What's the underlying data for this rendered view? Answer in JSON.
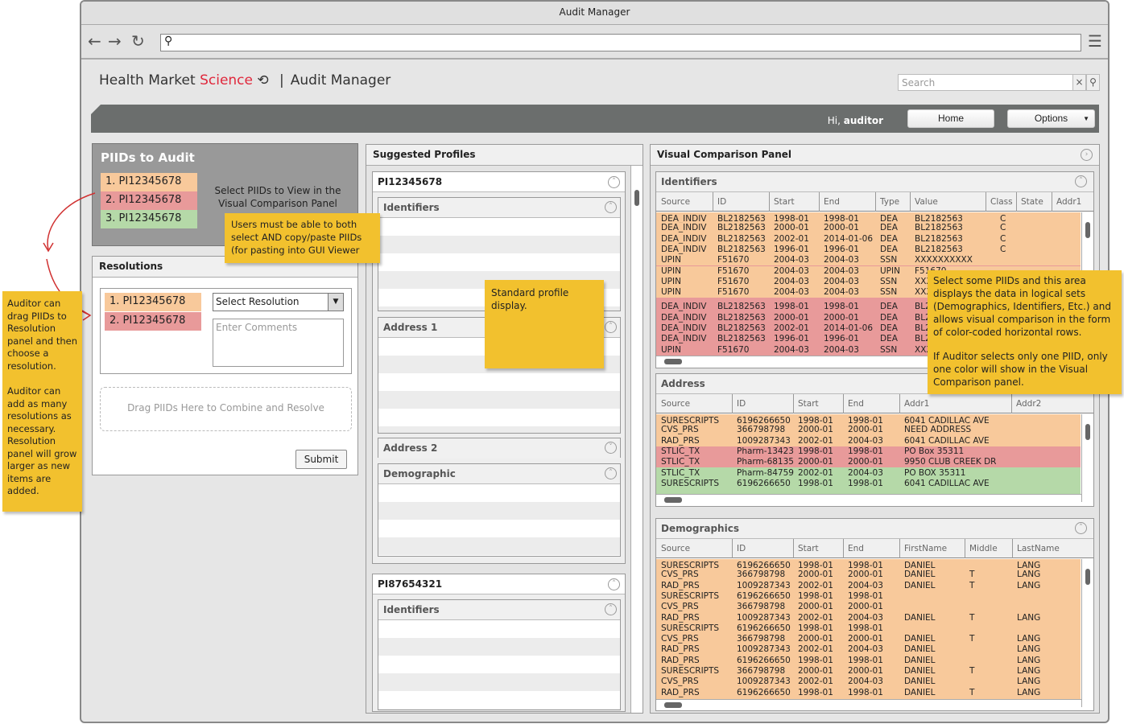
{
  "window": {
    "title": "Audit Manager"
  },
  "browser": {
    "back": "←",
    "forward": "→",
    "reload": "↻",
    "menu": "☰"
  },
  "header": {
    "brand_a": "Health Market ",
    "brand_b": "Science",
    "separator": "|",
    "app": "Audit Manager",
    "search_placeholder": "Search",
    "greeting": "Hi, ",
    "user": "auditor",
    "home": "Home",
    "options": "Options"
  },
  "piids_panel": {
    "title": "PIIDs to Audit",
    "hint": "Select PIIDs to View in the Visual Comparison Panel",
    "items": [
      {
        "label": "1.  PI12345678",
        "color": "#f8c99b"
      },
      {
        "label": "2.  PI12345678",
        "color": "#e89a9a"
      },
      {
        "label": "3.  PI12345678",
        "color": "#b5d9a8"
      }
    ]
  },
  "resolutions": {
    "title": "Resolutions",
    "items": [
      "1.  PI12345678",
      "2.  PI12345678"
    ],
    "select_value": "Select Resolution",
    "comments_placeholder": "Enter Comments",
    "drop_zone": "Drag PIIDs Here to Combine and Resolve",
    "submit": "Submit"
  },
  "suggested": {
    "title": "Suggested Profiles",
    "profiles": [
      {
        "id": "PI12345678",
        "sections": [
          "Identifiers",
          "Address 1",
          "Address 2",
          "Demographic"
        ]
      },
      {
        "id": "PI87654321",
        "sections": [
          "Identifiers"
        ]
      }
    ]
  },
  "visual": {
    "title": "Visual Comparison Panel",
    "identifiers": {
      "title": "Identifiers",
      "columns": [
        "Source",
        "ID",
        "Start",
        "End",
        "Type",
        "Value",
        "Class",
        "State",
        "Addr1"
      ],
      "rows": [
        {
          "c": "o",
          "v": [
            "DEA_INDIV",
            "BL2182563",
            "1998-01",
            "1998-01",
            "DEA",
            "BL2182563",
            "C",
            "",
            ""
          ]
        },
        {
          "c": "o",
          "v": [
            "DEA_INDIV",
            "BL2182563",
            "2000-01",
            "2000-01",
            "DEA",
            "BL2182563",
            "C",
            "",
            ""
          ]
        },
        {
          "c": "o",
          "v": [
            "DEA_INDIV",
            "BL2182563",
            "2002-01",
            "2014-01-06",
            "DEA",
            "BL2182563",
            "C",
            "",
            ""
          ]
        },
        {
          "c": "o",
          "v": [
            "DEA_INDIV",
            "BL2182563",
            "1996-01",
            "1996-01",
            "DEA",
            "BL2182563",
            "C",
            "",
            ""
          ]
        },
        {
          "c": "o",
          "v": [
            "UPIN",
            "F51670",
            "2004-03",
            "2004-03",
            "SSN",
            "XXXXXXXXXX",
            "",
            "",
            ""
          ]
        },
        {
          "c": "o",
          "v": [
            "UPIN",
            "F51670",
            "2004-03",
            "2004-03",
            "UPIN",
            "F51670",
            "",
            "",
            ""
          ]
        },
        {
          "c": "o",
          "v": [
            "UPIN",
            "F51670",
            "2004-03",
            "2004-03",
            "SSN",
            "XXXXXXXXXX",
            "",
            "",
            ""
          ]
        },
        {
          "c": "o",
          "v": [
            "UPIN",
            "F51670",
            "2004-03",
            "2004-03",
            "SSN",
            "XXXXXXXXXX",
            "",
            "",
            ""
          ]
        },
        {
          "c": "r",
          "v": [
            "DEA_INDIV",
            "BL2182563",
            "1998-01",
            "1998-01",
            "DEA",
            "BL2182563",
            "",
            "",
            ""
          ]
        },
        {
          "c": "r",
          "v": [
            "DEA_INDIV",
            "BL2182563",
            "2000-01",
            "2000-01",
            "DEA",
            "BL2182563",
            "",
            "",
            ""
          ]
        },
        {
          "c": "r",
          "v": [
            "DEA_INDIV",
            "BL2182563",
            "2002-01",
            "2014-01-06",
            "DEA",
            "BL2182563",
            "",
            "",
            ""
          ]
        },
        {
          "c": "r",
          "v": [
            "DEA_INDIV",
            "BL2182563",
            "1996-01",
            "1996-01",
            "DEA",
            "BL2182563",
            "",
            "",
            ""
          ]
        },
        {
          "c": "r",
          "v": [
            "UPIN",
            "F51670",
            "2004-03",
            "2004-03",
            "SSN",
            "XXXXXXXXXX",
            "",
            "",
            ""
          ]
        }
      ]
    },
    "address": {
      "title": "Address",
      "columns": [
        "Source",
        "ID",
        "Start",
        "End",
        "Addr1",
        "Addr2"
      ],
      "rows": [
        {
          "c": "o",
          "v": [
            "SURESCRIPTS",
            "6196266650",
            "1998-01",
            "1998-01",
            "6041 CADILLAC AVE",
            ""
          ]
        },
        {
          "c": "o",
          "v": [
            "CVS_PRS",
            "366798798",
            "2000-01",
            "2000-01",
            "NEED ADDRESS",
            ""
          ]
        },
        {
          "c": "o",
          "v": [
            "RAD_PRS",
            "1009287343",
            "2002-01",
            "2004-03",
            "6041 CADILLAC AVE",
            ""
          ]
        },
        {
          "c": "r",
          "v": [
            "STLIC_TX",
            "Pharm-13423",
            "1998-01",
            "1998-01",
            "PO Box 35311",
            ""
          ]
        },
        {
          "c": "r",
          "v": [
            "STLIC_TX",
            "Pharm-68135",
            "2000-01",
            "2000-01",
            "9950 CLUB CREEK DR",
            ""
          ]
        },
        {
          "c": "g",
          "v": [
            "STLIC_TX",
            "Pharm-84759",
            "2002-01",
            "2004-03",
            "PO BOX 35311",
            ""
          ]
        },
        {
          "c": "g",
          "v": [
            "SURESCRIPTS",
            "6196266650",
            "1998-01",
            "1998-01",
            "6041 CADILLAC AVE",
            ""
          ]
        }
      ]
    },
    "demographics": {
      "title": "Demographics",
      "columns": [
        "Source",
        "ID",
        "Start",
        "End",
        "FirstName",
        "Middle",
        "LastName"
      ],
      "rows": [
        {
          "c": "o",
          "v": [
            "SURESCRIPTS",
            "6196266650",
            "1998-01",
            "1998-01",
            "DANIEL",
            "",
            "LANG"
          ]
        },
        {
          "c": "o",
          "v": [
            "CVS_PRS",
            "366798798",
            "2000-01",
            "2000-01",
            "DANIEL",
            "T",
            "LANG"
          ]
        },
        {
          "c": "o",
          "v": [
            "RAD_PRS",
            "1009287343",
            "2002-01",
            "2004-03",
            "DANIEL",
            "T",
            "LANG"
          ]
        },
        {
          "c": "o",
          "v": [
            "SURESCRIPTS",
            "6196266650",
            "1998-01",
            "1998-01",
            "",
            "",
            ""
          ]
        },
        {
          "c": "o",
          "v": [
            "CVS_PRS",
            "366798798",
            "2000-01",
            "2000-01",
            "",
            "",
            ""
          ]
        },
        {
          "c": "o",
          "v": [
            "RAD_PRS",
            "1009287343",
            "2002-01",
            "2004-03",
            "DANIEL",
            "T",
            "LANG"
          ]
        },
        {
          "c": "o",
          "v": [
            "SURESCRIPTS",
            "6196266650",
            "1998-01",
            "1998-01",
            "",
            "",
            ""
          ]
        },
        {
          "c": "o",
          "v": [
            "CVS_PRS",
            "366798798",
            "2000-01",
            "2000-01",
            "DANIEL",
            "T",
            "LANG"
          ]
        },
        {
          "c": "o",
          "v": [
            "RAD_PRS",
            "1009287343",
            "2002-01",
            "2004-03",
            "DANIEL",
            "",
            "LANG"
          ]
        },
        {
          "c": "o",
          "v": [
            "RAD_PRS",
            "6196266650",
            "1998-01",
            "1998-01",
            "DANIEL",
            "",
            "LANG"
          ]
        },
        {
          "c": "o",
          "v": [
            "SURESCRIPTS",
            "366798798",
            "2000-01",
            "2000-01",
            "DANIEL",
            "T",
            "LANG"
          ]
        },
        {
          "c": "o",
          "v": [
            "CVS_PRS",
            "1009287343",
            "2002-01",
            "2004-03",
            "DANIEL",
            "",
            "LANG"
          ]
        },
        {
          "c": "o",
          "v": [
            "RAD_PRS",
            "6196266650",
            "1998-01",
            "1998-01",
            "DANIEL",
            "T",
            "LANG"
          ]
        }
      ]
    }
  },
  "notes": {
    "users": "Users must be able to both select AND copy/paste PIIDs (for pasting into GUI Viewer",
    "auditor": "Auditor can drag PIIDs to Resolution panel and then choose a resolution.",
    "auditor2": "Auditor can add as many resolutions as necessary. Resolution panel will grow larger as new items are added.",
    "standard": "Standard profile display.",
    "select": "Select some PIIDs and this area displays the data in logical sets (Demographics, Identifiers, Etc.) and allows visual comparison in the form of color-coded horizontal rows.",
    "single": "If Auditor selects only one PIID, only one color will show in the Visual Comparison panel."
  },
  "colors": {
    "orange": "#f8c99b",
    "red": "#e89a9a",
    "green": "#b5d9a8",
    "note": "#f2c12e",
    "header_bar": "#6b6e6d",
    "brand_red": "#e0283c"
  }
}
